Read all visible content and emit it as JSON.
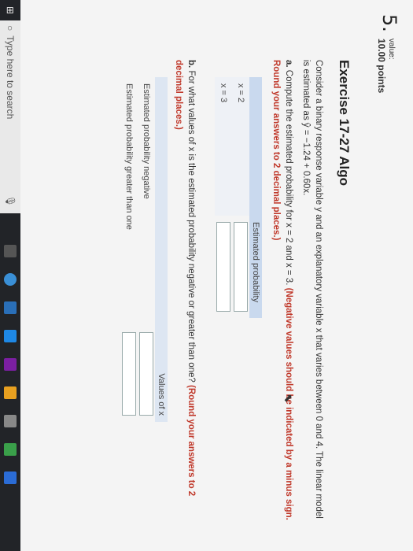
{
  "question": {
    "number": "5.",
    "value_label": "value:",
    "points": "10.00 points"
  },
  "exercise": {
    "title": "Exercise 17-27 Algo",
    "intro": "Consider a binary response variable y and an explanatory variable x that varies between 0 and 4. The linear model is estimated as ŷ = −1.24 + 0.60x.",
    "part_a_prefix": "a.",
    "part_a_text": "Compute the estimated probability for x = 2 and x = 3.",
    "part_a_note": "(Negative values should be indicated by a minus sign. Round your answers to 2 decimal places.)",
    "table_a": {
      "header": "Estimated probability",
      "rows": [
        "x = 2",
        "x = 3"
      ]
    },
    "part_b_prefix": "b.",
    "part_b_text": "For what values of x is the estimated probability negative or greater than one?",
    "part_b_note": "(Round your answers to 2 decimal places.)",
    "table_b": {
      "header": "Values of x",
      "rows": [
        "Estimated probability negative",
        "Estimated probability greater than one"
      ]
    }
  },
  "taskbar": {
    "search_placeholder": "Type here to search"
  },
  "colors": {
    "accent_red": "#c0392b",
    "table_header": "#c9d9ee"
  }
}
